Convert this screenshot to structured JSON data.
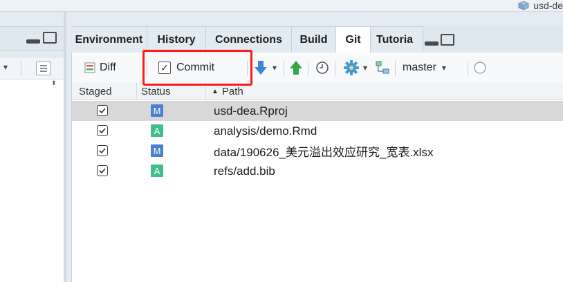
{
  "project": {
    "label": "usd-de"
  },
  "tabs": [
    {
      "label": "Environment",
      "active": false
    },
    {
      "label": "History",
      "active": false
    },
    {
      "label": "Connections",
      "active": false
    },
    {
      "label": "Build",
      "active": false
    },
    {
      "label": "Git",
      "active": true
    },
    {
      "label": "Tutoria",
      "active": false
    }
  ],
  "toolbar": {
    "diff_label": "Diff",
    "commit_label": "Commit",
    "branch_label": "master"
  },
  "columns": {
    "staged": "Staged",
    "status": "Status",
    "path": "Path"
  },
  "files": [
    {
      "staged": true,
      "status": "M",
      "path": "usd-dea.Rproj",
      "selected": true
    },
    {
      "staged": true,
      "status": "A",
      "path": "analysis/demo.Rmd",
      "selected": false
    },
    {
      "staged": true,
      "status": "M",
      "path": "data/190626_美元溢出效应研究_宽表.xlsx",
      "selected": false
    },
    {
      "staged": true,
      "status": "A",
      "path": "refs/add.bib",
      "selected": false
    }
  ],
  "colors": {
    "modified": "#4a7fd4",
    "added": "#3fbf8a",
    "highlight": "#ff1a1a",
    "pull_arrow": "#3d86d8",
    "push_arrow": "#2ea84a"
  }
}
